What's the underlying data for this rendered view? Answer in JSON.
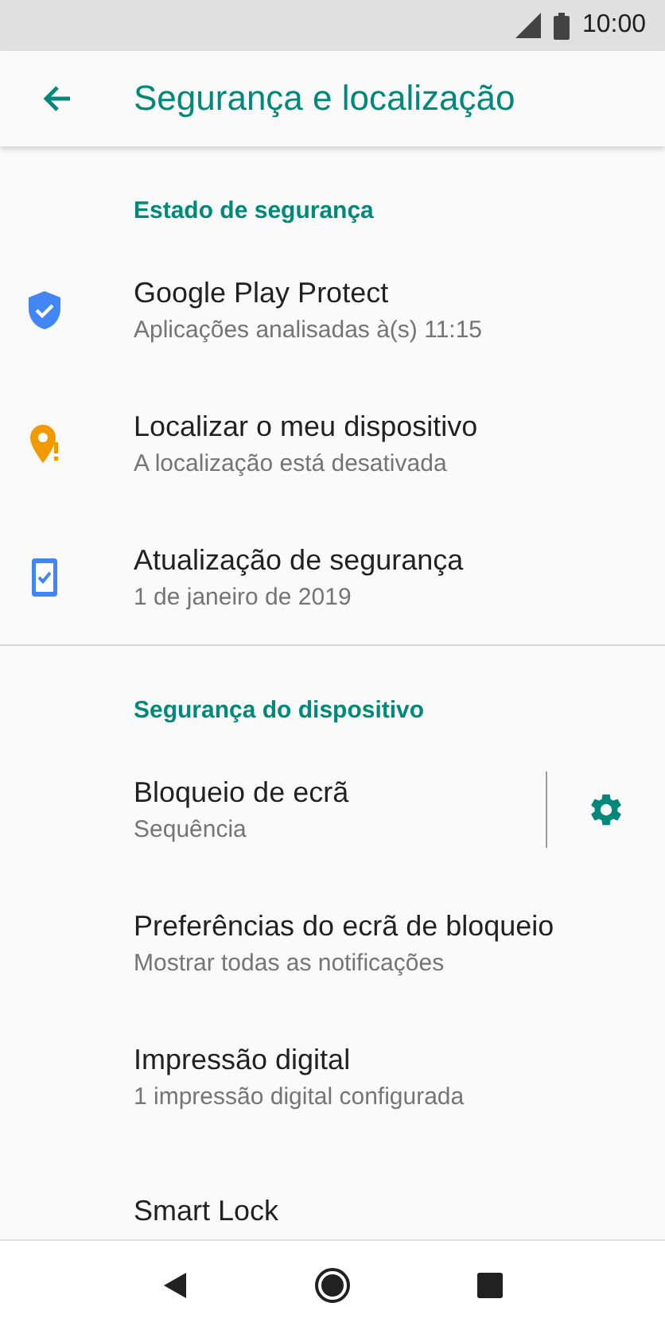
{
  "status_bar": {
    "time": "10:00"
  },
  "app_bar": {
    "title": "Segurança e localização"
  },
  "sections": [
    {
      "header": "Estado de segurança",
      "divider": false,
      "items": [
        {
          "kind": "shield",
          "title": "Google Play Protect",
          "subtitle": "Aplicações analisadas à(s) 11:15"
        },
        {
          "kind": "pin",
          "title": "Localizar o meu dispositivo",
          "subtitle": "A localização está desativada"
        },
        {
          "kind": "phone",
          "title": "Atualização de segurança",
          "subtitle": "1 de janeiro de 2019"
        }
      ]
    },
    {
      "header": "Segurança do dispositivo",
      "divider": true,
      "items": [
        {
          "kind": "settings",
          "title": "Bloqueio de ecrã",
          "subtitle": "Sequência"
        },
        {
          "kind": "plain",
          "title": "Preferências do ecrã de bloqueio",
          "subtitle": "Mostrar todas as notificações"
        },
        {
          "kind": "plain",
          "title": "Impressão digital",
          "subtitle": "1 impressão digital configurada"
        },
        {
          "kind": "plain",
          "title": "Smart Lock"
        }
      ]
    }
  ]
}
